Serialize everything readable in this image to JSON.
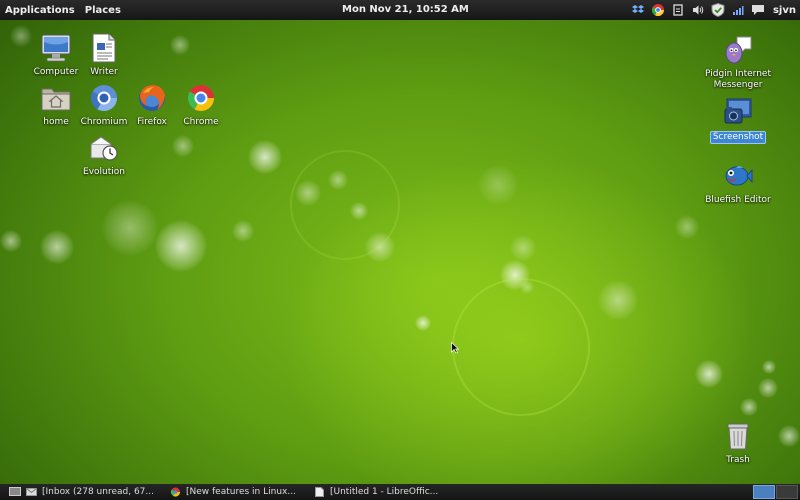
{
  "top_panel": {
    "menus": {
      "applications": "Applications",
      "places": "Places"
    },
    "clock": "Mon Nov 21, 10:52 AM",
    "tray_icons": [
      "dropbox-icon",
      "chrome-icon",
      "clipboard-icon",
      "volume-icon",
      "shield-icon",
      "network-signal-icon",
      "chat-icon"
    ],
    "user": "sjvn"
  },
  "desktop": {
    "icons": {
      "computer": "Computer",
      "writer": "Writer",
      "home": "home",
      "chromium": "Chromium",
      "firefox": "Firefox",
      "chrome": "Chrome",
      "evolution": "Evolution",
      "pidgin": "Pidgin Internet Messenger",
      "screenshot": "Screenshot",
      "bluefish": "Bluefish Editor",
      "trash": "Trash"
    },
    "selected_icon": "Screenshot"
  },
  "taskbar": {
    "tasks": [
      "[Inbox (278 unread, 67...",
      "[New features in Linux...",
      "[Untitled 1 - LibreOffic..."
    ],
    "workspaces": 2,
    "active_workspace": 1
  },
  "colors": {
    "panel": "#1c1c1c",
    "wallpaper_green": "#6aaa16",
    "selection": "#3d86d6"
  }
}
